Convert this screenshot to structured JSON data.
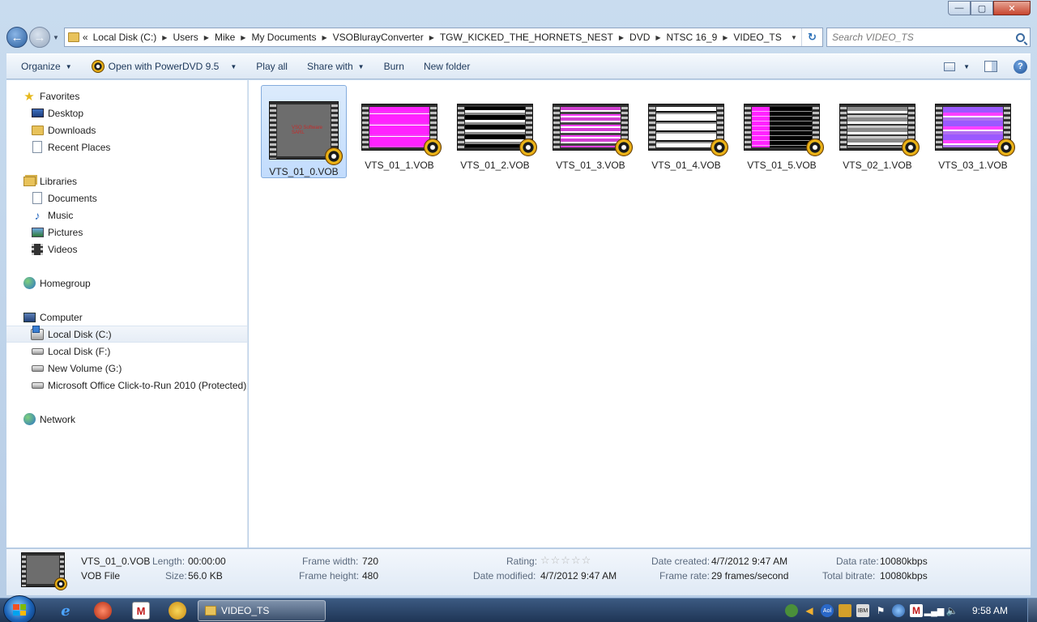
{
  "window": {
    "caption_buttons": {
      "minimize": "—",
      "maximize": "▢",
      "close": "✕"
    }
  },
  "address": {
    "overflow": "«",
    "crumbs": [
      "Local Disk (C:)",
      "Users",
      "Mike",
      "My Documents",
      "VSOBlurayConverter",
      "TGW_KICKED_THE_HORNETS_NEST",
      "DVD",
      "NTSC 16_9",
      "VIDEO_TS"
    ],
    "search_placeholder": "Search VIDEO_TS"
  },
  "toolbar": {
    "organize": "Organize",
    "open_with": "Open with PowerDVD 9.5",
    "play_all": "Play all",
    "share_with": "Share with",
    "burn": "Burn",
    "new_folder": "New folder",
    "help": "?"
  },
  "nav": {
    "favorites": "Favorites",
    "desktop": "Desktop",
    "downloads": "Downloads",
    "recent_places": "Recent Places",
    "libraries": "Libraries",
    "documents": "Documents",
    "music": "Music",
    "pictures": "Pictures",
    "videos": "Videos",
    "homegroup": "Homegroup",
    "computer": "Computer",
    "local_disk_c": "Local Disk (C:)",
    "local_disk_f": "Local Disk (F:)",
    "new_volume_g": "New Volume (G:)",
    "office_c2r": "Microsoft Office Click-to-Run 2010 (Protected)",
    "network": "Network"
  },
  "files": [
    {
      "name": "VTS_01_0.VOB",
      "selected": true,
      "watermark": "VSO Software SARL"
    },
    {
      "name": "VTS_01_1.VOB"
    },
    {
      "name": "VTS_01_2.VOB"
    },
    {
      "name": "VTS_01_3.VOB"
    },
    {
      "name": "VTS_01_4.VOB"
    },
    {
      "name": "VTS_01_5.VOB"
    },
    {
      "name": "VTS_02_1.VOB"
    },
    {
      "name": "VTS_03_1.VOB"
    }
  ],
  "details": {
    "file_name": "VTS_01_0.VOB",
    "file_type": "VOB File",
    "length_label": "Length:",
    "length": "00:00:00",
    "size_label": "Size:",
    "size": "56.0 KB",
    "frame_width_label": "Frame width:",
    "frame_width": "720",
    "frame_height_label": "Frame height:",
    "frame_height": "480",
    "rating_label": "Rating:",
    "rating_stars": "☆☆☆☆☆",
    "date_modified_label": "Date modified:",
    "date_modified": "4/7/2012 9:47 AM",
    "date_created_label": "Date created:",
    "date_created": "4/7/2012 9:47 AM",
    "frame_rate_label": "Frame rate:",
    "frame_rate": "29 frames/second",
    "data_rate_label": "Data rate:",
    "data_rate": "10080kbps",
    "total_bitrate_label": "Total bitrate:",
    "total_bitrate": "10080kbps"
  },
  "taskbar": {
    "ie_glyph": "e",
    "m_glyph": "M",
    "active_window": "VIDEO_TS",
    "tray": {
      "aol": "Aol",
      "ibm": "IBM",
      "mcafee": "M"
    },
    "clock": "9:58 AM"
  },
  "colors": {
    "selection": "#c2dcfd",
    "taskbar": "#1f3555",
    "toolbar_text": "#1e395b"
  }
}
